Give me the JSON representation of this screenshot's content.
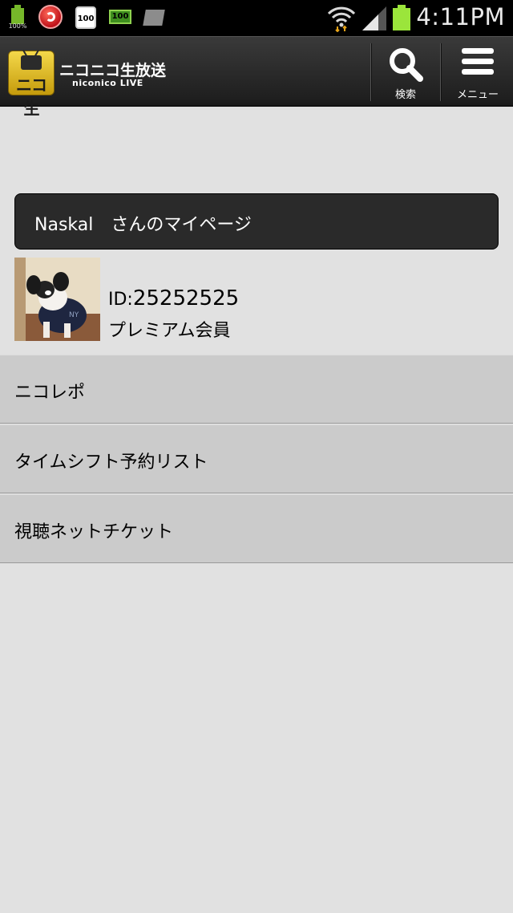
{
  "status_bar": {
    "battery_small_pct": "100%",
    "calendar_text": "100",
    "battery_widget_text": "100",
    "time": "4:11PM",
    "icons": [
      "battery-icon",
      "trend-micro-icon",
      "calendar-icon",
      "battery-widget-icon",
      "card-icon",
      "wifi-icon",
      "signal-icon",
      "battery-icon"
    ]
  },
  "header": {
    "logo_badge_text": "ニコ生",
    "logo_title": "ニコニコ生放送",
    "logo_subtitle": "niconico LIVE",
    "search_label": "検索",
    "menu_label": "メニュー"
  },
  "profile": {
    "title": "Naskal　さんのマイページ",
    "id_prefix": "ID:",
    "id_value": "25252525",
    "member_type": "プレミアム会員"
  },
  "menu": {
    "items": [
      {
        "label": "ニコレポ"
      },
      {
        "label": "タイムシフト予約リスト"
      },
      {
        "label": "視聴ネットチケット"
      }
    ]
  },
  "colors": {
    "background": "#e1e1e1",
    "header_bg": "#2a2a2a",
    "menu_item_bg": "#cbcbcb",
    "battery_green": "#9be53b",
    "logo_gold": "#e8c42c"
  }
}
